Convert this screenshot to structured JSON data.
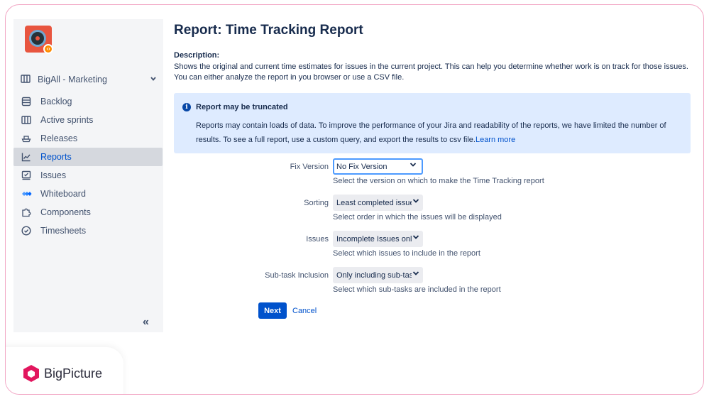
{
  "sidebar": {
    "project_logo": "project-avatar",
    "board_name": "BigAll - Marketing",
    "items": [
      {
        "label": "Backlog",
        "icon": "backlog-icon"
      },
      {
        "label": "Active sprints",
        "icon": "board-icon"
      },
      {
        "label": "Releases",
        "icon": "ship-icon"
      },
      {
        "label": "Reports",
        "icon": "chart-icon",
        "active": true
      },
      {
        "label": "Issues",
        "icon": "issues-icon"
      },
      {
        "label": "Whiteboard",
        "icon": "whiteboard-icon"
      },
      {
        "label": "Components",
        "icon": "puzzle-icon"
      },
      {
        "label": "Timesheets",
        "icon": "clock-icon"
      }
    ],
    "collapse_glyph": "«"
  },
  "page": {
    "title": "Report: Time Tracking Report",
    "description_heading": "Description:",
    "description_text": "Shows the original and current time estimates for issues in the current project. This can help you determine whether work is on track for those issues. You can either analyze the report in you browser or use a CSV file."
  },
  "info": {
    "title": "Report may be truncated",
    "body": "Reports may contain loads of data. To improve the performance of your Jira and readability of the reports, we have limited the number of results. To see a full report, use a custom query, and export the results to csv file.",
    "link": "Learn more"
  },
  "form": {
    "fix_version": {
      "label": "Fix Version",
      "value": "No Fix Version",
      "help": "Select the version on which to make the Time Tracking report"
    },
    "sorting": {
      "label": "Sorting",
      "value": "Least completed issues first",
      "help": "Select order in which the issues will be displayed"
    },
    "issues": {
      "label": "Issues",
      "value": "Incomplete Issues only",
      "help": "Select which issues to include in the report"
    },
    "subtask": {
      "label": "Sub-task Inclusion",
      "value": "Only including sub-tasks",
      "help": "Select which sub-tasks are included in the report"
    }
  },
  "buttons": {
    "next": "Next",
    "cancel": "Cancel"
  },
  "brand": {
    "name": "BigPicture"
  },
  "colors": {
    "accent": "#0052cc",
    "sidebar_bg": "#f4f5f7",
    "info_bg": "#deebff",
    "frame_border": "#f2a7c5",
    "brand_logo": "#e2165e"
  }
}
